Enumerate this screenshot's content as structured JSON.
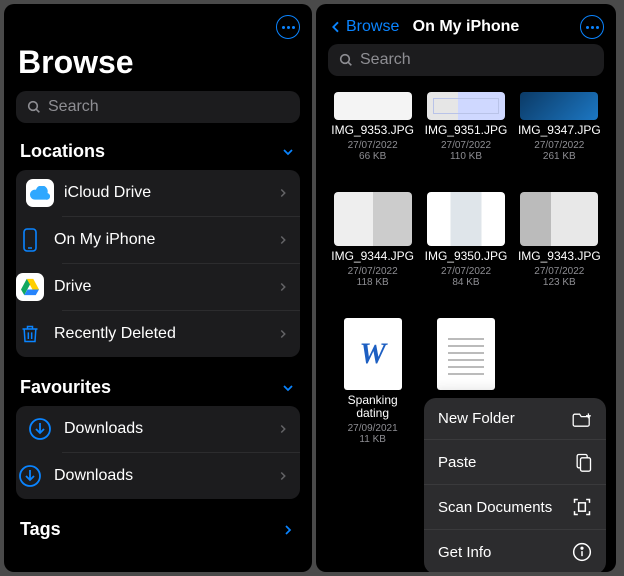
{
  "colors": {
    "accent": "#0a84ff"
  },
  "left": {
    "title": "Browse",
    "search_placeholder": "Search",
    "sections": {
      "locations": {
        "header": "Locations",
        "items": [
          {
            "label": "iCloud Drive",
            "icon": "icloud-icon"
          },
          {
            "label": "On My iPhone",
            "icon": "phone-icon"
          },
          {
            "label": "Drive",
            "icon": "gdrive-icon"
          },
          {
            "label": "Recently Deleted",
            "icon": "trash-icon"
          }
        ]
      },
      "favourites": {
        "header": "Favourites",
        "items": [
          {
            "label": "Downloads",
            "icon": "download-icon"
          },
          {
            "label": "Downloads",
            "icon": "download-icon"
          }
        ]
      },
      "tags": {
        "header": "Tags"
      }
    }
  },
  "right": {
    "back_label": "Browse",
    "title": "On My iPhone",
    "search_placeholder": "Search",
    "files": [
      {
        "name": "IMG_9353.JPG",
        "date": "27/07/2022",
        "size": "66 KB",
        "thumb": "t1"
      },
      {
        "name": "IMG_9351.JPG",
        "date": "27/07/2022",
        "size": "110 KB",
        "thumb": "t2"
      },
      {
        "name": "IMG_9347.JPG",
        "date": "27/07/2022",
        "size": "261 KB",
        "thumb": "t3"
      },
      {
        "name": "IMG_9344.JPG",
        "date": "27/07/2022",
        "size": "118 KB",
        "thumb": "t4"
      },
      {
        "name": "IMG_9350.JPG",
        "date": "27/07/2022",
        "size": "84 KB",
        "thumb": "t5"
      },
      {
        "name": "IMG_9343.JPG",
        "date": "27/07/2022",
        "size": "123 KB",
        "thumb": "t6"
      },
      {
        "name": "Spanking dating",
        "date": "27/09/2021",
        "size": "11 KB",
        "thumb": "docw"
      },
      {
        "name": "",
        "date": "",
        "size": "",
        "thumb": "doclines"
      }
    ],
    "menu": [
      {
        "label": "New Folder",
        "icon": "folder-plus-icon"
      },
      {
        "label": "Paste",
        "icon": "clipboard-icon"
      },
      {
        "label": "Scan Documents",
        "icon": "scan-icon"
      },
      {
        "label": "Get Info",
        "icon": "info-icon"
      }
    ]
  }
}
